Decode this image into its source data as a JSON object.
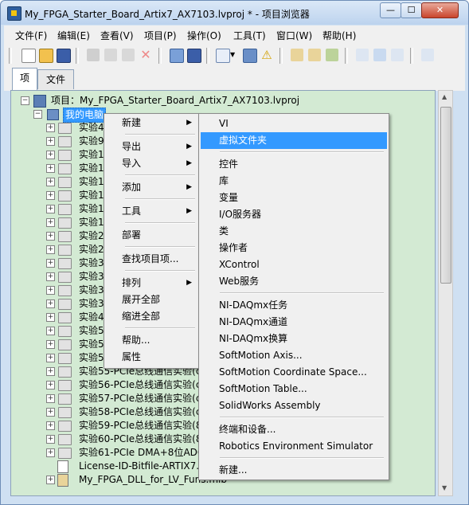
{
  "window": {
    "title": "My_FPGA_Starter_Board_Artix7_AX7103.lvproj * - 项目浏览器",
    "buttons": {
      "minimize": "—",
      "maximize": "☐",
      "close": "✕"
    }
  },
  "menubar": [
    "文件(F)",
    "编辑(E)",
    "查看(V)",
    "项目(P)",
    "操作(O)",
    "工具(T)",
    "窗口(W)",
    "帮助(H)"
  ],
  "tabs": [
    "项",
    "文件"
  ],
  "tree": {
    "project_label": "项目：My_FPGA_Starter_Board_Artix7_AX7103.lvproj",
    "computer_label": "我的电脑",
    "experiments": [
      "实验4",
      "实验9",
      "实验1",
      "实验1",
      "实验1",
      "实验1",
      "实验1",
      "实验1",
      "实验2",
      "实验2",
      "实验3",
      "实验3",
      "实验3",
      "实验3",
      "实验4",
      "实验5",
      "实验5",
      "实验5",
      "实验55-PCIe总线通信实验(c",
      "实验56-PCIe总线通信实验(c",
      "实验57-PCIe总线通信实验(c",
      "实验58-PCIe总线通信实验(c",
      "实验59-PCIe总线通信实验(8",
      "实验60-PCIe总线通信实验(8",
      "实验61-PCIe DMA+8位ADC"
    ],
    "files": [
      "License-ID-Bitfile-ARTIX7.v",
      "My_FPGA_DLL_for_LV_Funs.mlb"
    ]
  },
  "context_menu": {
    "items": [
      "新建",
      "导出",
      "导入",
      "添加",
      "工具",
      "部署",
      "查找项目项...",
      "排列",
      "展开全部",
      "缩进全部",
      "帮助...",
      "属性"
    ],
    "submenu_arrow": "▶"
  },
  "submenu_new": {
    "items": [
      "VI",
      "虚拟文件夹",
      "控件",
      "库",
      "变量",
      "I/O服务器",
      "类",
      "操作者",
      "XControl",
      "Web服务",
      "NI-DAQmx任务",
      "NI-DAQmx通道",
      "NI-DAQmx换算",
      "SoftMotion Axis...",
      "SoftMotion Coordinate Space...",
      "SoftMotion Table...",
      "SolidWorks Assembly",
      "终端和设备...",
      "Robotics Environment Simulator",
      "新建..."
    ],
    "highlighted": "虚拟文件夹"
  },
  "colors": {
    "tree_bg": "#d3ead3",
    "highlight": "#3399ff",
    "menu_bg": "#f0f0f0"
  }
}
